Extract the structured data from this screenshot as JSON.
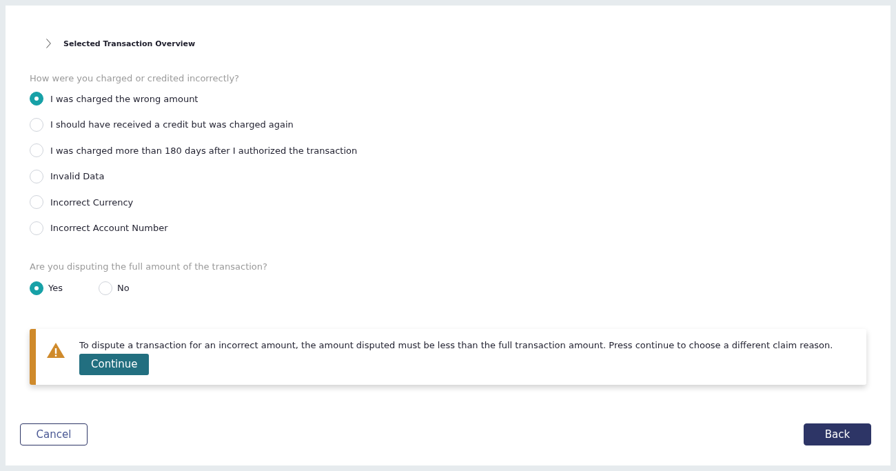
{
  "overview": {
    "title": "Selected Transaction Overview",
    "expanded": false
  },
  "questions": [
    {
      "prompt": "How were you charged or credited incorrectly?",
      "kind": "stacked",
      "options": [
        {
          "label": "I was charged the wrong amount",
          "selected": true
        },
        {
          "label": "I should have received a credit but was charged again",
          "selected": false
        },
        {
          "label": "I was charged more than 180 days after I authorized the transaction",
          "selected": false
        },
        {
          "label": "Invalid Data",
          "selected": false
        },
        {
          "label": "Incorrect Currency",
          "selected": false
        },
        {
          "label": "Incorrect Account Number",
          "selected": false
        }
      ]
    },
    {
      "prompt": "Are you disputing the full amount of the transaction?",
      "kind": "inline",
      "options": [
        {
          "label": "Yes",
          "selected": true
        },
        {
          "label": "No",
          "selected": false
        }
      ]
    }
  ],
  "alert": {
    "message": "To dispute a transaction for an incorrect amount, the amount disputed must be less than the full transaction amount. Press continue to choose a different claim reason.",
    "button": "Continue"
  },
  "buttons": [
    {
      "label": "Cancel",
      "kind": "secondary"
    },
    {
      "label": "Back",
      "kind": "primary"
    }
  ]
}
